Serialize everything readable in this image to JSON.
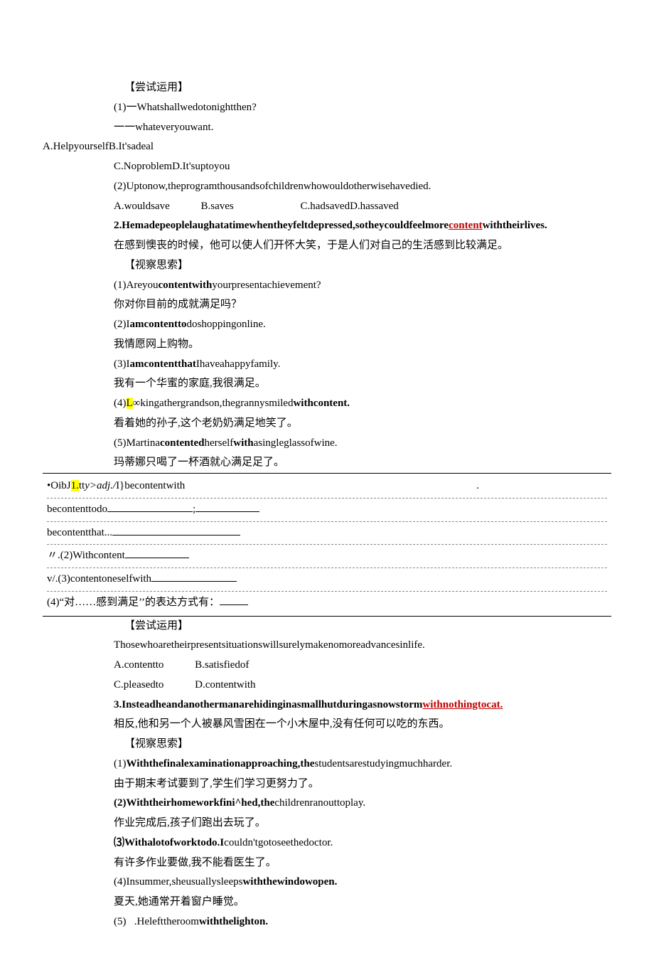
{
  "sec1": {
    "heading": "【尝试运用】",
    "q1_stem": "(1)一Whatshallwedotonightthen?",
    "q1_reply": "一一whateveryouwant.",
    "q1_choices_a": "A.HelpyourselfB.It'sadeal",
    "q1_choices_b": "C.NoproblemD.It'suptoyou",
    "q2_stem": "(2)Uptonow,theprogramthousandsofchildrenwhowouldotherwisehavedied.",
    "q2_a": "A.wouldsave",
    "q2_b": "B.saves",
    "q2_c": "C.hadsavedD.hassaved"
  },
  "sec2": {
    "lead_pre": "2.Hemadepeoplelaughatatimewhentheyfeltdepressed,sotheycouldfeelmore",
    "lead_hl": "content",
    "lead_post": "withtheirlives.",
    "cn1": "在感到懊丧的时候，他可以使人们开怀大笑，于是人们对自己的生活感到比较满足。",
    "obs": "【视察思索】",
    "l1": "(1)Areyou",
    "l1b": "contentwith",
    "l1c": "yourpresentachievement?",
    "l1cn": "你对你目前的成就满足吗？",
    "l2a": "(2)I",
    "l2b": "amcontentto",
    "l2c": "doshoppingonline.",
    "l2cn": "我情愿网上购物。",
    "l3a": "(3)I",
    "l3b": "amcontentthat",
    "l3c": "Ihaveahappyfamily.",
    "l3cn": "我有一个华蜜的家庭,我很满足。",
    "l4a": "(4)",
    "l4b": "L",
    "l4c": "∞kingathergrandson,thegrannysmiled",
    "l4d": "withcontent.",
    "l4cn": "看着她的孙子,这个老奶奶满足地笑了。",
    "l5a": "(5)Martina",
    "l5b": "contented",
    "l5c": "herself",
    "l5d": "with",
    "l5e": "asingleglassofwine.",
    "l5cn": "玛蒂娜只喝了一杯酒就心满足足了。"
  },
  "tablebox": {
    "r1a": "•OibJ",
    "r1a2": "1.",
    "r1b": "tt",
    "r1c": "y>",
    "r1d": "adj./",
    "r1e": "I}becontentwith",
    "r1tail": ".",
    "r2": "becontenttodo",
    "r2tail": ";",
    "r3": "becontentthat...",
    "r4a": "〃.(2)Withcontent",
    "r5a": "v/.(3)contentoneselfwith",
    "r6": "(4)“对……感到满足’’的表达方式有："
  },
  "sec3": {
    "heading": "【尝试运用】",
    "stem": "Thosewhoaretheirpresentsituationswillsurelymakenomoreadvancesinlife.",
    "a": "A.contentto",
    "b": "B.satisfiedof",
    "c": "C.pleasedto",
    "d": "D.contentwith"
  },
  "sec4": {
    "lead_pre": "3.Insteadheandanothermanarehidinginasmallhutduringasnowstorm",
    "lead_hl": "withnothingtocat.",
    "cn": "相反,他和另一个人被暴风雪困在一个小木屋中,没有任何可以吃的东西。",
    "obs": "【视察思索】",
    "l1a": "(1)",
    "l1b": "Withthefinalexaminationapproaching,the",
    "l1c": "studentsarestudyingmuchharder.",
    "l1cn": "由于期末考试要到了,学生们学习更努力了。",
    "l2a": "(2)Withtheirhomeworkfini^hed,the",
    "l2b": "childrenranouttoplay.",
    "l2cn": "作业完成后,孩子们跑出去玩了。",
    "l3a": "⑶Withalotofworktodo.I",
    "l3b": "couldn'tgotoseethedoctor.",
    "l3cn": "有许多作业要做,我不能看医生了。",
    "l4a": "(4)Insummer,sheusuallysleeps",
    "l4b": "withthewindowopen.",
    "l4cn": "夏天,她通常开着窗户睡觉。",
    "l5a": "(5)",
    "l5b": ".Helefttheroom",
    "l5c": "withthelighton."
  }
}
